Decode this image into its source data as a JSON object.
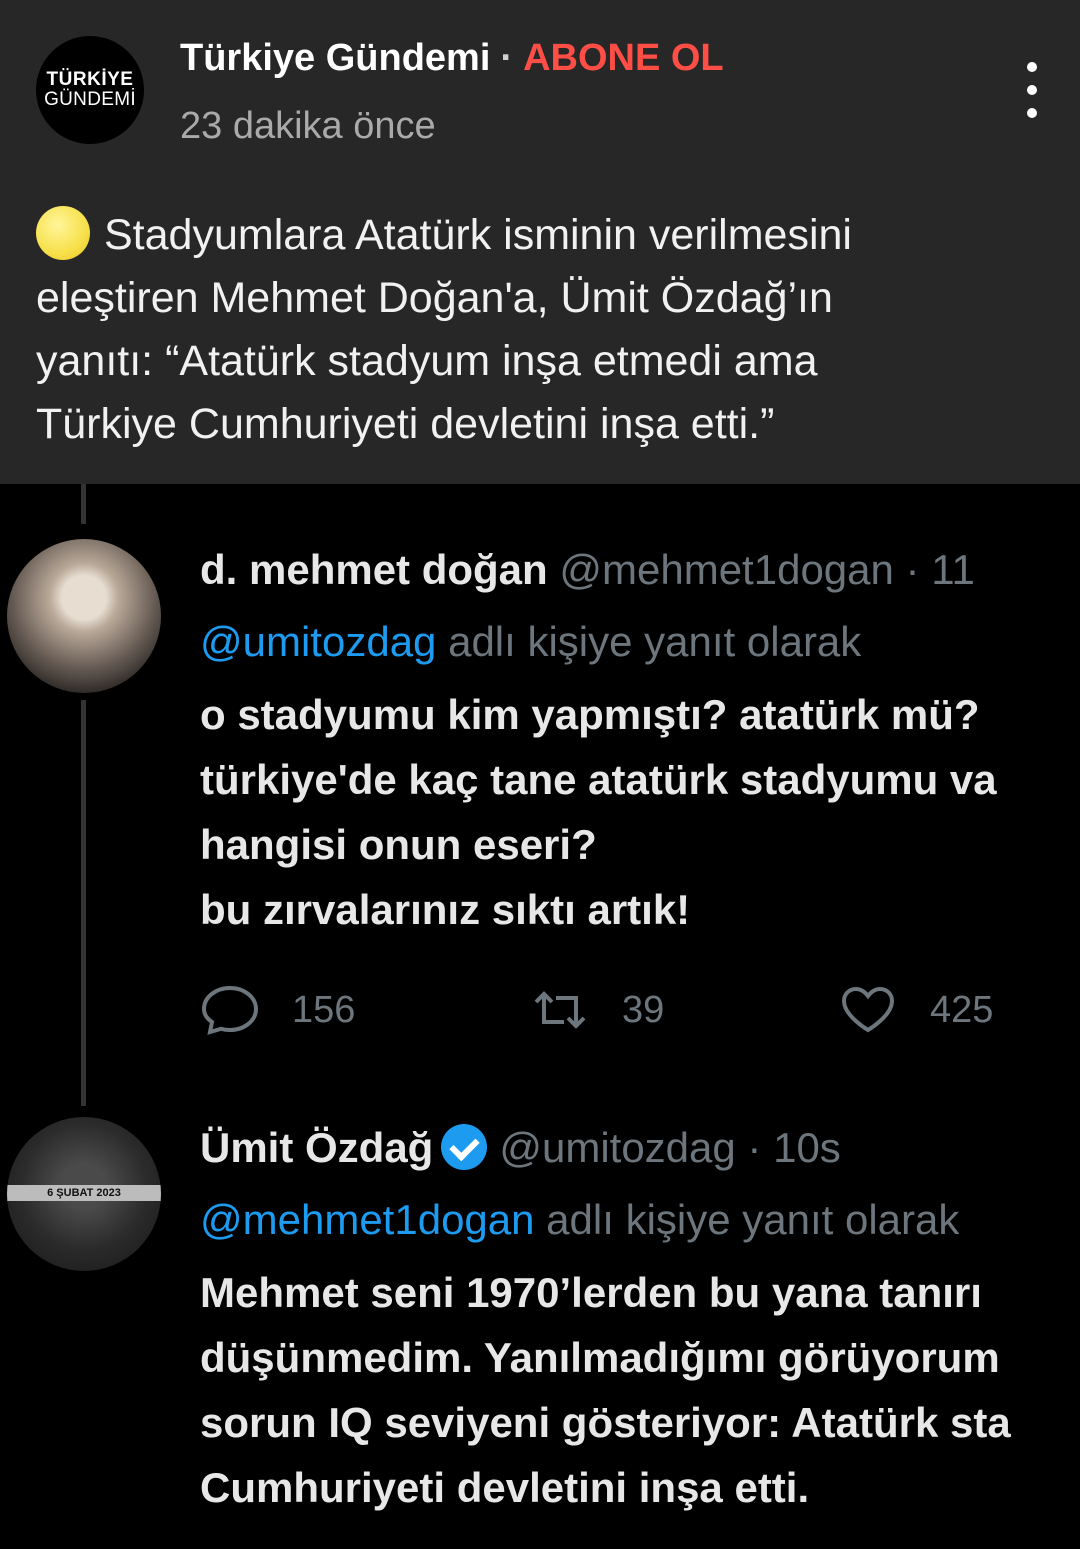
{
  "channel": {
    "logo_line1": "TÜRKİYE",
    "logo_line2": "GÜNDEMİ",
    "name": "Türkiye Gündemi",
    "separator": "·",
    "subscribe_label": "ABONE OL",
    "time": "23 dakika önce",
    "menu_icon": "more-vert-icon"
  },
  "post": {
    "emoji": "yellow-circle-icon",
    "lines": [
      "Stadyumlara Atatürk isminin verilmesini",
      "eleştiren Mehmet Doğan'a, Ümit Özdağ’ın",
      "yanıtı: “Atatürk stadyum inşa etmedi ama",
      "Türkiye Cumhuriyeti devletini inşa etti.”"
    ]
  },
  "tweet1": {
    "name": "d. mehmet doğan",
    "handle": "@mehmet1dogan · 11",
    "reply_mention": "@umitozdag",
    "reply_text": " adlı kişiye yanıt olarak",
    "lines": [
      "o stadyumu kim yapmıştı? atatürk mü?",
      "türkiye'de kaç tane atatürk stadyumu va",
      "hangisi onun eseri?",
      "bu zırvalarınız sıktı artık!"
    ],
    "replies": "156",
    "retweets": "39",
    "likes": "425"
  },
  "tweet2": {
    "name": "Ümit Özdağ",
    "handle": "@umitozdag · 10s",
    "avatar_text": "6 ŞUBAT 2023",
    "reply_mention": "@mehmet1dogan",
    "reply_text": " adlı kişiye yanıt olarak",
    "lines": [
      "Mehmet seni 1970’lerden bu yana tanırı",
      "düşünmedim. Yanılmadığımı görüyorum",
      "sorun IQ seviyeni gösteriyor: Atatürk sta",
      "Cumhuriyeti devletini inşa etti."
    ]
  },
  "colors": {
    "header_bg": "#272727",
    "subscribe": "#ff4e45",
    "mention": "#1d9bf0",
    "muted": "#6e767d"
  }
}
